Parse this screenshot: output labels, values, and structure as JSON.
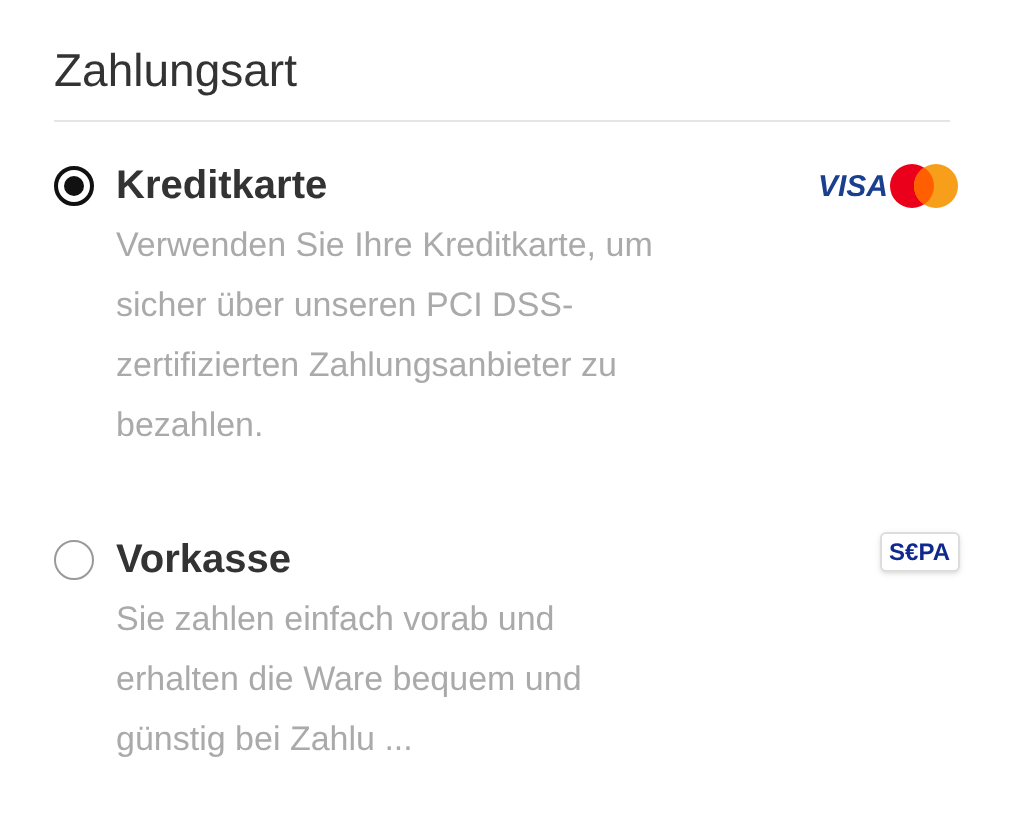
{
  "title": "Zahlungsart",
  "options": [
    {
      "label": "Kreditkarte",
      "selected": true,
      "description": "Verwenden Sie Ihre Kreditkarte, um sicher über unseren PCI DSS-zertifizierten Zahlungsanbieter zu bezahlen.",
      "logo": {
        "kind": "visa-mastercard",
        "text": "VISA"
      }
    },
    {
      "label": "Vorkasse",
      "selected": false,
      "description": "Sie zahlen einfach vorab und erhalten die Ware bequem und günstig bei Zahlu ...",
      "logo": {
        "kind": "sepa",
        "text": "S€PA"
      }
    }
  ]
}
